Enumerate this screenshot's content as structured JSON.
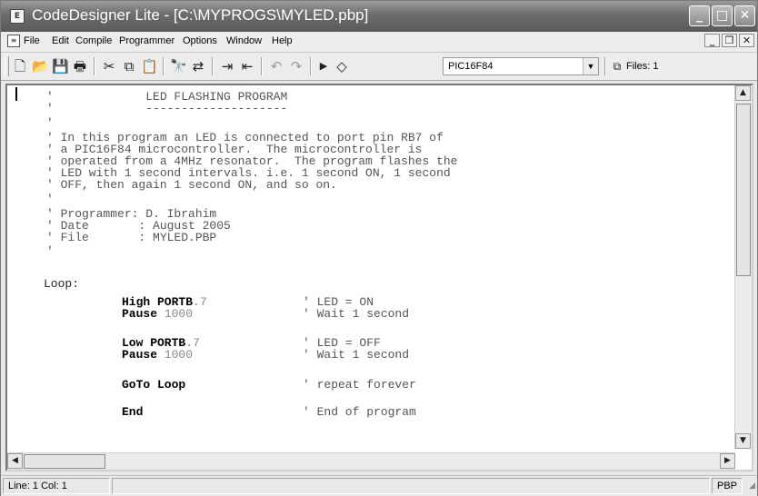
{
  "window": {
    "title": "CodeDesigner Lite - [C:\\MYPROGS\\MYLED.pbp]",
    "controls": {
      "minimize": "_",
      "maximize": "□",
      "close": "✕"
    }
  },
  "menu": {
    "items": [
      "File",
      "Edit",
      "Compile",
      "Programmer",
      "Options",
      "Window",
      "Help"
    ],
    "mdi_controls": {
      "minimize": "_",
      "restore": "❐",
      "close": "✕"
    }
  },
  "toolbar": {
    "device_select": "PIC16F84",
    "files_label": "Files: 1"
  },
  "editor": {
    "header": [
      "'             LED FLASHING PROGRAM",
      "'             --------------------",
      "'",
      "' In this program an LED is connected to port pin RB7 of",
      "' a PIC16F84 microcontroller.  The microcontroller is",
      "' operated from a 4MHz resonator.  The program flashes the",
      "' LED with 1 second intervals. i.e. 1 second ON, 1 second",
      "' OFF, then again 1 second ON, and so on.",
      "'",
      "' Programmer: D. Ibrahim",
      "' Date       : August 2005",
      "' File       : MYLED.PBP",
      "'"
    ],
    "label": "Loop:",
    "statements": [
      {
        "kw": "High PORTB",
        "arg": ".7",
        "comment": "' LED = ON"
      },
      {
        "kw": "Pause",
        "arg": " 1000",
        "comment": "' Wait 1 second"
      },
      {
        "kw": "Low PORTB",
        "arg": ".7",
        "comment": "' LED = OFF"
      },
      {
        "kw": "Pause",
        "arg": " 1000",
        "comment": "' Wait 1 second"
      },
      {
        "kw": "GoTo Loop",
        "arg": "",
        "comment": "' repeat forever"
      },
      {
        "kw": "End",
        "arg": "",
        "comment": "' End of program"
      }
    ]
  },
  "status": {
    "position": "Line: 1 Col: 1",
    "mode": "PBP"
  }
}
